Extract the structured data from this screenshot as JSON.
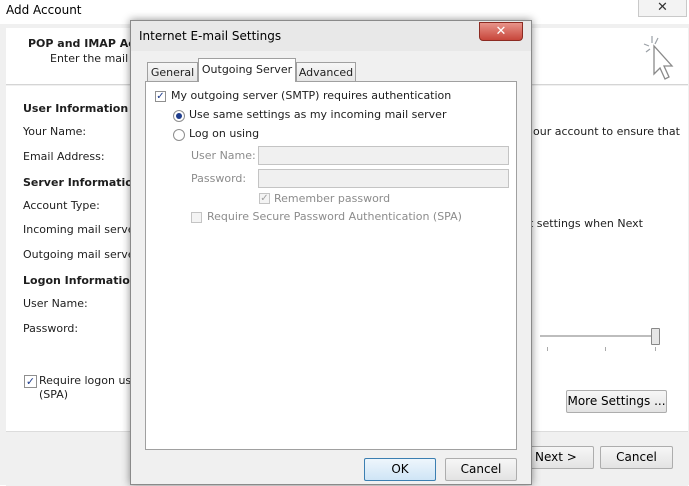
{
  "background_window": {
    "title": "Add Account",
    "close_glyph": "✕",
    "header_title": "POP and IMAP Acco",
    "header_subtitle": "Enter the mail se",
    "body_text_right": "our account to ensure that",
    "body_text_right2": "nt settings when Next",
    "sections": {
      "user_info": "User Information",
      "your_name": "Your Name:",
      "email_address": "Email Address:",
      "server_info": "Server Information",
      "account_type": "Account Type:",
      "incoming_server": "Incoming mail server:",
      "outgoing_server": "Outgoing mail server",
      "logon_info": "Logon Information",
      "user_name": "User Name:",
      "password": "Password:"
    },
    "spa_checkbox": {
      "label_line1": "Require logon usi",
      "label_line2": "(SPA)",
      "checked": true,
      "check_glyph": "✓"
    },
    "buttons": {
      "more_settings": "More Settings ...",
      "next": "Next >",
      "cancel": "Cancel"
    }
  },
  "dialog": {
    "title": "Internet E-mail Settings",
    "close_glyph": "✕",
    "tabs": [
      {
        "label": "General",
        "selected": false
      },
      {
        "label": "Outgoing Server",
        "selected": true
      },
      {
        "label": "Advanced",
        "selected": false
      }
    ],
    "smtp_auth": {
      "label": "My outgoing server (SMTP) requires authentication",
      "checked": true,
      "check_glyph": "✓"
    },
    "radio_same_settings": {
      "label": "Use same settings as my incoming mail server",
      "selected": true
    },
    "radio_log_on_using": {
      "label": "Log on using",
      "selected": false
    },
    "user_name_label": "User Name:",
    "user_name_value": "",
    "password_label": "Password:",
    "password_value": "",
    "remember_password": {
      "label": "Remember password",
      "checked": true,
      "enabled": false,
      "check_glyph": "✓"
    },
    "require_spa": {
      "label": "Require Secure Password Authentication (SPA)",
      "checked": false,
      "enabled": false
    },
    "buttons": {
      "ok": "OK",
      "cancel": "Cancel"
    }
  },
  "colors": {
    "accent_check": "#1e3c8c",
    "close_button": "#c7463b",
    "default_button_border": "#3c7fb1"
  }
}
